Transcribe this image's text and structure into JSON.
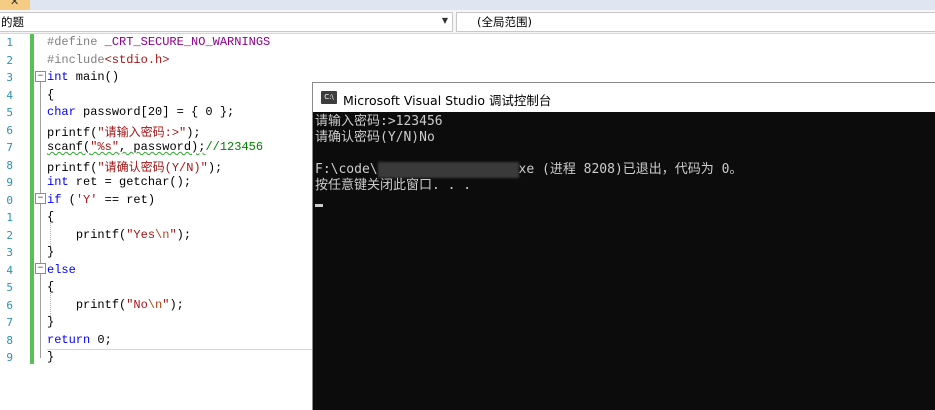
{
  "nav": {
    "scope_left": "的题",
    "scope_right": "(全局范围)"
  },
  "editor": {
    "line_numbers": [
      "1",
      "2",
      "3",
      "4",
      "5",
      "6",
      "7",
      "8",
      "9",
      "0",
      "1",
      "2",
      "3",
      "4",
      "5",
      "6",
      "7",
      "8",
      "9"
    ],
    "code": {
      "define_kw": "#define",
      "define_macro": "_CRT_SECURE_NO_WARNINGS",
      "include_kw": "#include",
      "include_file": "<stdio.h>",
      "main_kw": "int",
      "main_rest": " main()",
      "brace_open": "{",
      "char_kw": "char",
      "char_rest": " password[20] = { 0 };",
      "printf1_fn": "printf(",
      "printf1_str": "\"请输入密码:>\"",
      "printf1_end": ");",
      "scanf_fn": "scanf(",
      "scanf_str": "\"%s\"",
      "scanf_mid": ", password);",
      "scanf_cmt": "//123456",
      "printf2_fn": "printf(",
      "printf2_str": "\"请确认密码(Y/N)\"",
      "printf2_end": ");",
      "ret_kw": "int",
      "ret_rest": " ret = getchar();",
      "if_kw": "if",
      "if_open": " (",
      "if_char": "'Y'",
      "if_rest": " == ret)",
      "brace_open2": "{",
      "printf_yes_fn": "printf(",
      "printf_yes_str1": "\"Yes",
      "printf_yes_esc": "\\n",
      "printf_yes_str2": "\"",
      "printf_yes_end": ");",
      "brace_close2": "}",
      "else_kw": "else",
      "brace_open3": "{",
      "printf_no_fn": "printf(",
      "printf_no_str1": "\"No",
      "printf_no_esc": "\\n",
      "printf_no_str2": "\"",
      "printf_no_end": ");",
      "brace_close3": "}",
      "return_kw": "return",
      "return_rest": " 0;",
      "brace_close": "}"
    }
  },
  "console": {
    "title": "Microsoft Visual Studio 调试控制台",
    "app_icon": "C:\\",
    "lines": [
      "请输入密码:>123456",
      "请确认密码(Y/N)No",
      "",
      "F:\\code\\",
      "按任意键关闭此窗口. . ."
    ],
    "line4_tail": "xe (进程 8208)已退出，代码为 0。"
  },
  "colors": {
    "keyword": "#0000ff",
    "string": "#a31515",
    "comment": "#008000",
    "preprocessor": "#808080",
    "macro": "#8b008b",
    "line_number": "#2b91af",
    "console_bg": "#0c0c0c",
    "console_text": "#cccccc",
    "change_bar": "#57c057"
  }
}
